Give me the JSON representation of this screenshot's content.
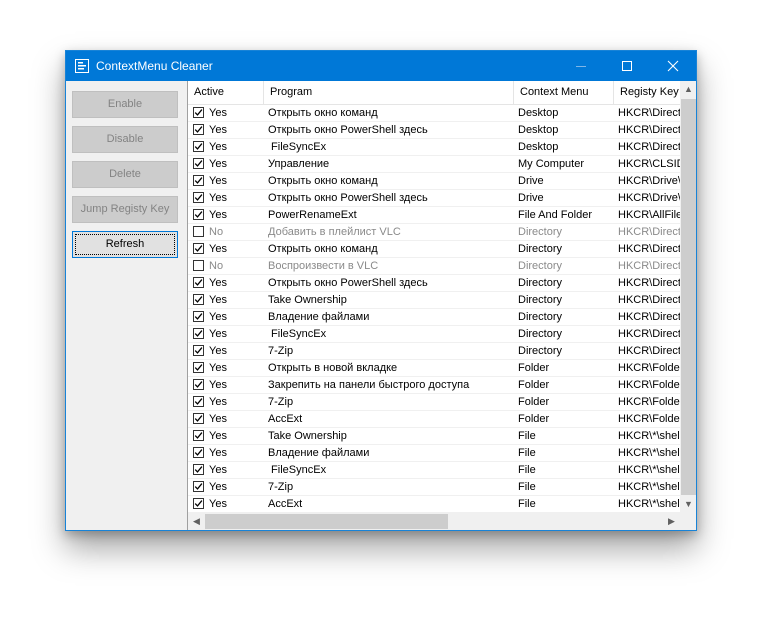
{
  "window": {
    "title": "ContextMenu Cleaner"
  },
  "sidebar": {
    "buttons": [
      {
        "label": "Enable",
        "enabled": false
      },
      {
        "label": "Disable",
        "enabled": false
      },
      {
        "label": "Delete",
        "enabled": false
      },
      {
        "label": "Jump Registy Key",
        "enabled": false
      },
      {
        "label": "Refresh",
        "enabled": true
      }
    ]
  },
  "table": {
    "columns": [
      "Active",
      "Program",
      "Context Menu",
      "Registy Key"
    ],
    "rows": [
      {
        "checked": true,
        "active": "Yes",
        "program": "Открыть окно команд",
        "menu": "Desktop",
        "key": "HKCR\\Directo"
      },
      {
        "checked": true,
        "active": "Yes",
        "program": "Открыть окно PowerShell здесь",
        "menu": "Desktop",
        "key": "HKCR\\Directo"
      },
      {
        "checked": true,
        "active": "Yes",
        "program": " FileSyncEx",
        "menu": "Desktop",
        "key": "HKCR\\Directo"
      },
      {
        "checked": true,
        "active": "Yes",
        "program": "Управление",
        "menu": "My Computer",
        "key": "HKCR\\CLSID"
      },
      {
        "checked": true,
        "active": "Yes",
        "program": "Открыть окно команд",
        "menu": "Drive",
        "key": "HKCR\\Drive\\"
      },
      {
        "checked": true,
        "active": "Yes",
        "program": "Открыть окно PowerShell здесь",
        "menu": "Drive",
        "key": "HKCR\\Drive\\"
      },
      {
        "checked": true,
        "active": "Yes",
        "program": "PowerRenameExt",
        "menu": "File And Folder",
        "key": "HKCR\\AllFiles"
      },
      {
        "checked": false,
        "active": "No",
        "program": "Добавить в плейлист VLC",
        "menu": "Directory",
        "key": "HKCR\\Directo"
      },
      {
        "checked": true,
        "active": "Yes",
        "program": "Открыть окно команд",
        "menu": "Directory",
        "key": "HKCR\\Directo"
      },
      {
        "checked": false,
        "active": "No",
        "program": "Воспроизвести в VLC",
        "menu": "Directory",
        "key": "HKCR\\Directo"
      },
      {
        "checked": true,
        "active": "Yes",
        "program": "Открыть окно PowerShell здесь",
        "menu": "Directory",
        "key": "HKCR\\Directo"
      },
      {
        "checked": true,
        "active": "Yes",
        "program": "Take Ownership",
        "menu": "Directory",
        "key": "HKCR\\Directo"
      },
      {
        "checked": true,
        "active": "Yes",
        "program": "Владение файлами",
        "menu": "Directory",
        "key": "HKCR\\Directo"
      },
      {
        "checked": true,
        "active": "Yes",
        "program": " FileSyncEx",
        "menu": "Directory",
        "key": "HKCR\\Directo"
      },
      {
        "checked": true,
        "active": "Yes",
        "program": "7-Zip",
        "menu": "Directory",
        "key": "HKCR\\Directo"
      },
      {
        "checked": true,
        "active": "Yes",
        "program": "Открыть в новой вкладке",
        "menu": "Folder",
        "key": "HKCR\\Folder"
      },
      {
        "checked": true,
        "active": "Yes",
        "program": "Закрепить на панели быстрого доступа",
        "menu": "Folder",
        "key": "HKCR\\Folder"
      },
      {
        "checked": true,
        "active": "Yes",
        "program": "7-Zip",
        "menu": "Folder",
        "key": "HKCR\\Folder"
      },
      {
        "checked": true,
        "active": "Yes",
        "program": "AccExt",
        "menu": "Folder",
        "key": "HKCR\\Folder"
      },
      {
        "checked": true,
        "active": "Yes",
        "program": "Take Ownership",
        "menu": "File",
        "key": "HKCR\\*\\shel"
      },
      {
        "checked": true,
        "active": "Yes",
        "program": "Владение файлами",
        "menu": "File",
        "key": "HKCR\\*\\shel"
      },
      {
        "checked": true,
        "active": "Yes",
        "program": " FileSyncEx",
        "menu": "File",
        "key": "HKCR\\*\\shel"
      },
      {
        "checked": true,
        "active": "Yes",
        "program": "7-Zip",
        "menu": "File",
        "key": "HKCR\\*\\shel"
      },
      {
        "checked": true,
        "active": "Yes",
        "program": "AccExt",
        "menu": "File",
        "key": "HKCR\\*\\shel"
      }
    ]
  },
  "icons": {
    "app": "app-icon",
    "minimize": "minimize-icon",
    "maximize": "maximize-icon",
    "close": "close-icon",
    "scroll_up": "▲",
    "scroll_down": "▼",
    "scroll_left": "◀",
    "scroll_right": "▶"
  }
}
